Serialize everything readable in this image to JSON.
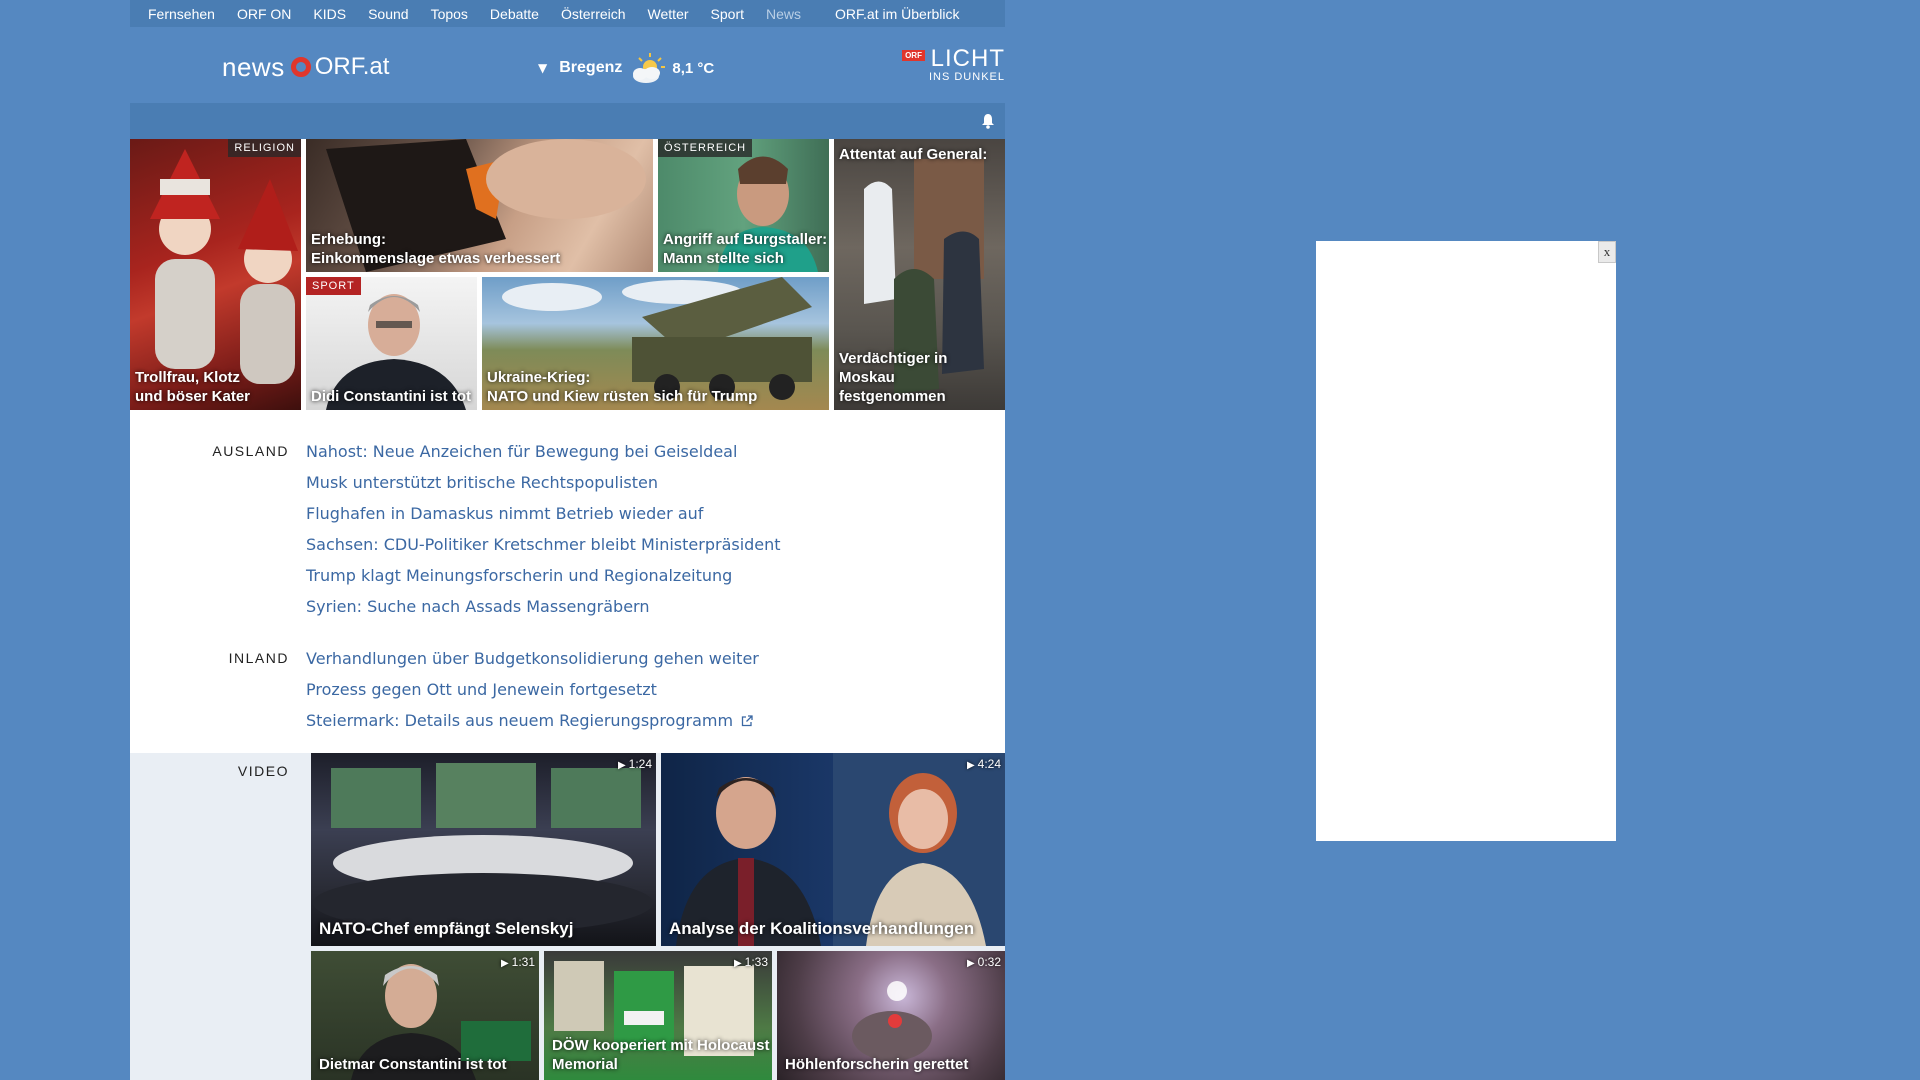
{
  "topnav": {
    "items": [
      "Fernsehen",
      "ORF ON",
      "KIDS",
      "Sound",
      "Topos",
      "Debatte",
      "Österreich",
      "Wetter",
      "Sport",
      "News"
    ],
    "active_index": 9,
    "overview": "ORF.at im Überblick"
  },
  "header": {
    "logo_news": "news",
    "logo_orf": "ORF.at",
    "weather": {
      "city": "Bregenz",
      "temp": "8,1 °C",
      "icon": "partly-cloudy-icon"
    },
    "licht": {
      "badge": "ORF",
      "big": "LICHT",
      "small": "INS DUNKEL"
    }
  },
  "tiles": {
    "t1": {
      "title": "Trollfrau, Klotz\nund böser Kater",
      "badge": "RELIGION"
    },
    "t2": {
      "title": "Erhebung:\nEinkommenslage etwas verbessert"
    },
    "t3": {
      "title": "Angriff auf Burgstaller:\nMann stellte sich",
      "badge": "ÖSTERREICH"
    },
    "t4": {
      "title_top": "Attentat auf General:",
      "title": "Verdächtiger in\nMoskau festgenommen"
    },
    "t5": {
      "title": "Didi Constantini ist tot",
      "badge": "SPORT"
    },
    "t6": {
      "title": "Ukraine-Krieg:\nNATO und Kiew rüsten sich für Trump"
    }
  },
  "ausland": {
    "title": "AUSLAND",
    "items": [
      "Nahost: Neue Anzeichen für Bewegung bei Geiseldeal",
      "Musk unterstützt britische Rechtspopulisten",
      "Flughafen in Damaskus nimmt Betrieb wieder auf",
      "Sachsen: CDU-Politiker Kretschmer bleibt Ministerpräsident",
      "Trump klagt Meinungsforscherin und Regionalzeitung",
      "Syrien: Suche nach Assads Massengräbern"
    ]
  },
  "inland": {
    "title": "INLAND",
    "items": [
      "Verhandlungen über Budgetkonsolidierung gehen weiter",
      "Prozess gegen Ott und Jenewein fortgesetzt",
      "Steiermark: Details aus neuem Regierungsprogramm"
    ]
  },
  "video": {
    "title": "VIDEO",
    "items": [
      {
        "title": "NATO-Chef empfängt Selenskyj",
        "duration": "1:24"
      },
      {
        "title": "Analyse der Koalitionsverhandlungen",
        "duration": "4:24"
      },
      {
        "title": "Dietmar Constantini ist tot",
        "duration": "1:31"
      },
      {
        "title": "DÖW kooperiert mit Holocaust\nMemorial",
        "duration": "1:33"
      },
      {
        "title": "Höhlenforscherin gerettet",
        "duration": "0:32"
      }
    ]
  },
  "ad": {
    "close": "x"
  }
}
